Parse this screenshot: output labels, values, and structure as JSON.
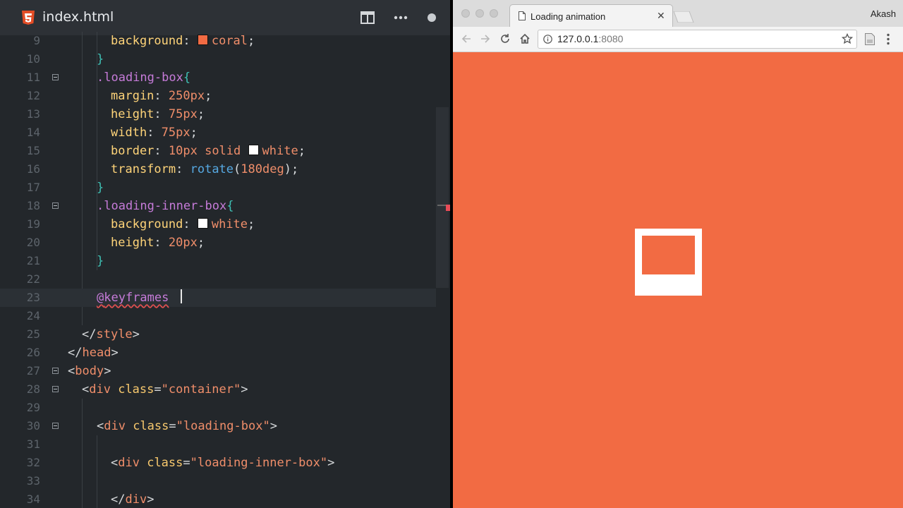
{
  "editor": {
    "tab_title": "index.html",
    "lines": [
      {
        "n": "9",
        "tokens": [
          {
            "t": "background",
            "c": "prop"
          },
          {
            "t": ": ",
            "c": "punc"
          },
          {
            "sw": "#f26b43"
          },
          {
            "t": "coral",
            "c": "val"
          },
          {
            "t": ";",
            "c": "punc"
          }
        ]
      },
      {
        "n": "10",
        "tokens": [
          {
            "t": "}",
            "c": "brace"
          }
        ]
      },
      {
        "n": "11",
        "tokens": [
          {
            "t": ".loading-box",
            "c": "sel"
          },
          {
            "t": "{",
            "c": "brace"
          }
        ]
      },
      {
        "n": "12",
        "tokens": [
          {
            "t": "margin",
            "c": "prop"
          },
          {
            "t": ": ",
            "c": "punc"
          },
          {
            "t": "250px",
            "c": "num"
          },
          {
            "t": ";",
            "c": "punc"
          }
        ]
      },
      {
        "n": "13",
        "tokens": [
          {
            "t": "height",
            "c": "prop"
          },
          {
            "t": ": ",
            "c": "punc"
          },
          {
            "t": "75px",
            "c": "num"
          },
          {
            "t": ";",
            "c": "punc"
          }
        ]
      },
      {
        "n": "14",
        "tokens": [
          {
            "t": "width",
            "c": "prop"
          },
          {
            "t": ": ",
            "c": "punc"
          },
          {
            "t": "75px",
            "c": "num"
          },
          {
            "t": ";",
            "c": "punc"
          }
        ]
      },
      {
        "n": "15",
        "tokens": [
          {
            "t": "border",
            "c": "prop"
          },
          {
            "t": ": ",
            "c": "punc"
          },
          {
            "t": "10px solid ",
            "c": "num"
          },
          {
            "sw": "#ffffff"
          },
          {
            "t": "white",
            "c": "val"
          },
          {
            "t": ";",
            "c": "punc"
          }
        ]
      },
      {
        "n": "16",
        "tokens": [
          {
            "t": "transform",
            "c": "prop"
          },
          {
            "t": ": ",
            "c": "punc"
          },
          {
            "t": "rotate",
            "c": "func"
          },
          {
            "t": "(",
            "c": "punc"
          },
          {
            "t": "180deg",
            "c": "num"
          },
          {
            "t": ");",
            "c": "punc"
          }
        ]
      },
      {
        "n": "17",
        "tokens": [
          {
            "t": "}",
            "c": "brace"
          }
        ]
      },
      {
        "n": "18",
        "tokens": [
          {
            "t": ".loading-inner-box",
            "c": "sel"
          },
          {
            "t": "{",
            "c": "brace"
          }
        ]
      },
      {
        "n": "19",
        "tokens": [
          {
            "t": "background",
            "c": "prop"
          },
          {
            "t": ": ",
            "c": "punc"
          },
          {
            "sw": "#ffffff"
          },
          {
            "t": "white",
            "c": "val"
          },
          {
            "t": ";",
            "c": "punc"
          }
        ]
      },
      {
        "n": "20",
        "tokens": [
          {
            "t": "height",
            "c": "prop"
          },
          {
            "t": ": ",
            "c": "punc"
          },
          {
            "t": "20px",
            "c": "num"
          },
          {
            "t": ";",
            "c": "punc"
          }
        ]
      },
      {
        "n": "21",
        "tokens": [
          {
            "t": "}",
            "c": "brace"
          }
        ]
      },
      {
        "n": "22",
        "tokens": []
      },
      {
        "n": "23",
        "tokens": [
          {
            "t": "@",
            "c": "at",
            "sq": true
          },
          {
            "t": "keyframes",
            "c": "at",
            "sq": true
          },
          {
            "t": " ",
            "c": "plain"
          }
        ]
      },
      {
        "n": "24",
        "tokens": []
      },
      {
        "n": "25",
        "tokens": [
          {
            "t": "</",
            "c": "punc"
          },
          {
            "t": "style",
            "c": "tag"
          },
          {
            "t": ">",
            "c": "punc"
          }
        ]
      },
      {
        "n": "26",
        "tokens": [
          {
            "t": "</",
            "c": "punc"
          },
          {
            "t": "head",
            "c": "tag"
          },
          {
            "t": ">",
            "c": "punc"
          }
        ]
      },
      {
        "n": "27",
        "tokens": [
          {
            "t": "<",
            "c": "punc"
          },
          {
            "t": "body",
            "c": "tag"
          },
          {
            "t": ">",
            "c": "punc"
          }
        ]
      },
      {
        "n": "28",
        "tokens": [
          {
            "t": "<",
            "c": "punc"
          },
          {
            "t": "div",
            "c": "tag"
          },
          {
            "t": " class",
            "c": "attr"
          },
          {
            "t": "=",
            "c": "punc"
          },
          {
            "t": "\"container\"",
            "c": "str"
          },
          {
            "t": ">",
            "c": "punc"
          }
        ]
      },
      {
        "n": "29",
        "tokens": []
      },
      {
        "n": "30",
        "tokens": [
          {
            "t": "<",
            "c": "punc"
          },
          {
            "t": "div",
            "c": "tag"
          },
          {
            "t": " class",
            "c": "attr"
          },
          {
            "t": "=",
            "c": "punc"
          },
          {
            "t": "\"loading-box\"",
            "c": "str"
          },
          {
            "t": ">",
            "c": "punc"
          }
        ]
      },
      {
        "n": "31",
        "tokens": []
      },
      {
        "n": "32",
        "tokens": [
          {
            "t": "<",
            "c": "punc"
          },
          {
            "t": "div",
            "c": "tag"
          },
          {
            "t": " class",
            "c": "attr"
          },
          {
            "t": "=",
            "c": "punc"
          },
          {
            "t": "\"loading-inner-box\"",
            "c": "str"
          },
          {
            "t": ">",
            "c": "punc"
          }
        ]
      },
      {
        "n": "33",
        "tokens": []
      },
      {
        "n": "34",
        "tokens": [
          {
            "t": "</",
            "c": "punc"
          },
          {
            "t": "div",
            "c": "tag"
          },
          {
            "t": ">",
            "c": "punc"
          }
        ]
      }
    ]
  },
  "browser": {
    "tab_title": "Loading animation",
    "profile": "Akash",
    "url_host": "127.0.0.1",
    "url_port": ":8080",
    "page_background": "#f26b43"
  },
  "icons": [
    "html5-icon",
    "split-view-icon",
    "more-icon",
    "unsaved-dot-icon",
    "page-icon",
    "close-icon",
    "back-icon",
    "forward-icon",
    "reload-icon",
    "home-icon",
    "info-icon",
    "star-icon",
    "extension-icon",
    "menu-icon"
  ]
}
